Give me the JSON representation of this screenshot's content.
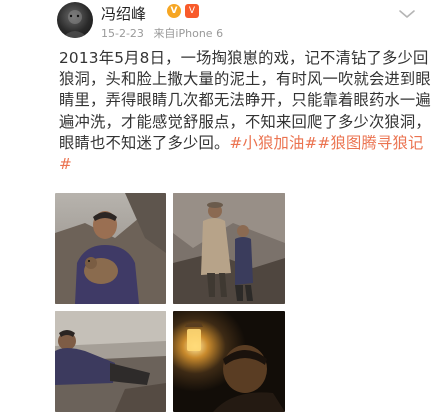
{
  "user": {
    "name": "冯绍峰",
    "badges": [
      "V",
      "V"
    ],
    "time": "15-2-23",
    "source": "来自iPhone 6"
  },
  "post": {
    "text": "2013年5月8日，一场掏狼崽的戏，记不清钻了多少回狼洞，头和脸上撒大量的泥土，有时风一吹就会进到眼睛里，弄得眼睛几次都无法睁开，只能靠着眼药水一遍遍冲洗，才能感觉舒服点，不知来回爬了多少次狼洞，眼睛也不知迷了多少回。",
    "hashtags": [
      "#小狼加油#",
      "#狼图腾寻狼记#"
    ]
  },
  "photos": [
    {
      "icon": "photo-man-with-wolf-pup"
    },
    {
      "icon": "photo-two-men-on-rocks"
    },
    {
      "icon": "photo-man-lying-on-ground"
    },
    {
      "icon": "photo-lantern-in-dark"
    }
  ],
  "colors": {
    "hashtag": "#eb7350",
    "meta": "#999999",
    "text": "#333333"
  }
}
